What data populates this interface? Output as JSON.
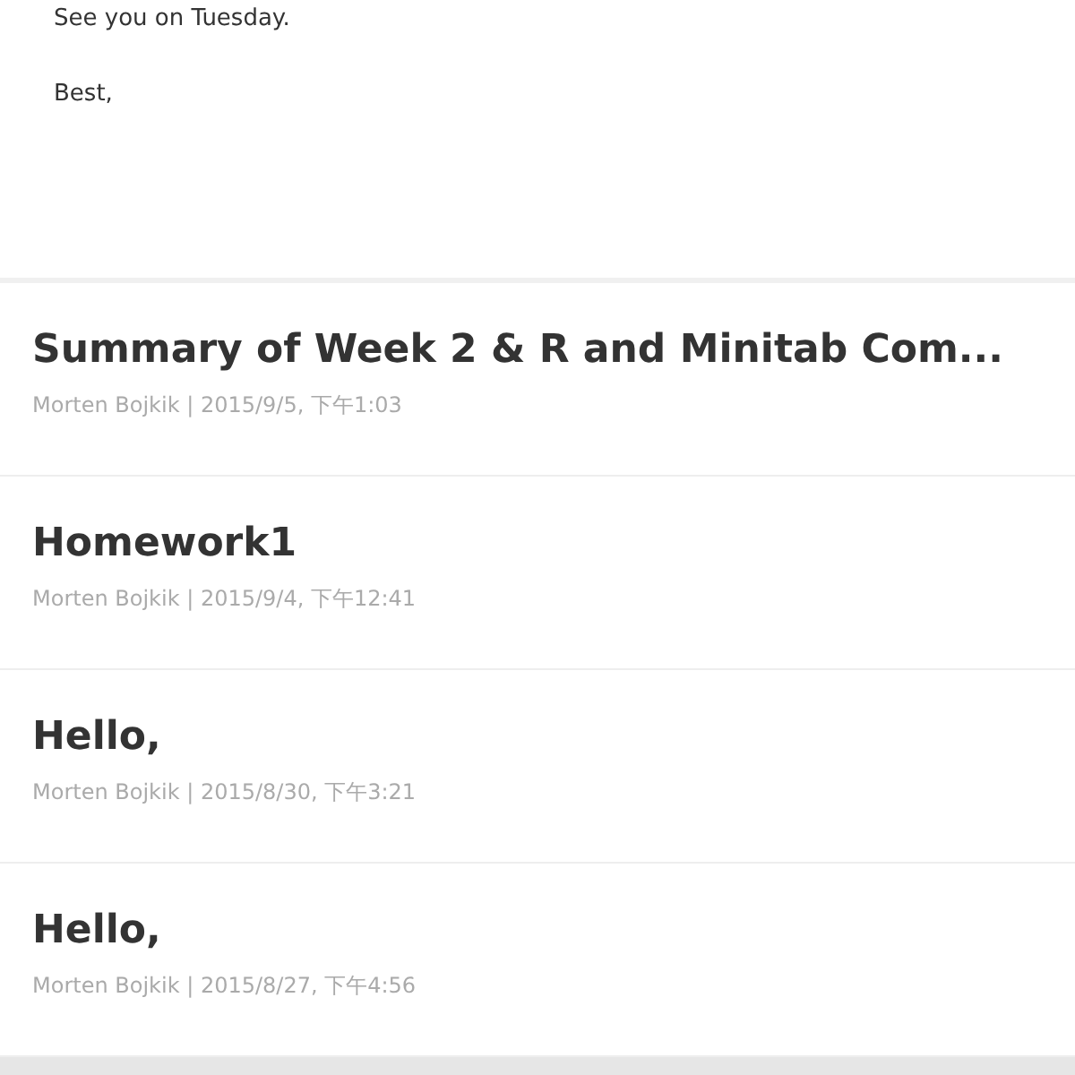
{
  "message_body": [
    "See you on Tuesday.",
    "Best,"
  ],
  "threads": [
    {
      "subject": "Summary of Week 2 & R and Minitab Com...",
      "meta": "Morten Bojkik | 2015/9/5, 下午1:03"
    },
    {
      "subject": "Homework1",
      "meta": "Morten Bojkik | 2015/9/4, 下午12:41"
    },
    {
      "subject": "Hello,",
      "meta": "Morten Bojkik | 2015/8/30, 下午3:21"
    },
    {
      "subject": "Hello,",
      "meta": "Morten Bojkik | 2015/8/27, 下午4:56"
    }
  ]
}
